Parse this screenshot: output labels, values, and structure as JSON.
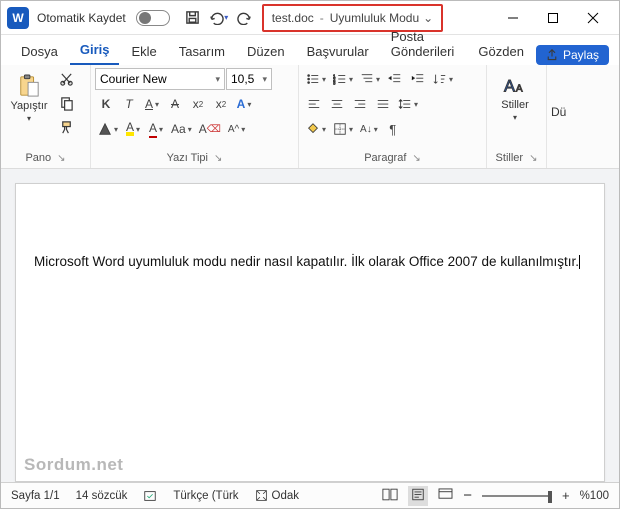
{
  "titlebar": {
    "autosave_label": "Otomatik Kaydet",
    "filename": "test.doc",
    "mode": "Uyumluluk Modu"
  },
  "tabs": {
    "dosya": "Dosya",
    "giris": "Giriş",
    "ekle": "Ekle",
    "tasarim": "Tasarım",
    "duzen": "Düzen",
    "basvurular": "Başvurular",
    "posta": "Posta Gönderileri",
    "gozden": "Gözden",
    "paylas": "Paylaş",
    "du": "Dü"
  },
  "ribbon": {
    "pano": {
      "label": "Pano",
      "paste": "Yapıştır"
    },
    "yazi": {
      "label": "Yazı Tipi",
      "font": "Courier New",
      "size": "10,5",
      "bold": "K",
      "italic": "T",
      "sub": "x",
      "sup": "x",
      "caseAa": "Aa",
      "clearA": "A",
      "fontA": "A",
      "colorA": "A",
      "highlightA": "A",
      "charA": "A",
      "underlineA": "A"
    },
    "para": {
      "label": "Paragraf"
    },
    "stil": {
      "label": "Stiller",
      "btn": "Stiller"
    }
  },
  "document": {
    "body": "Microsoft Word uyumluluk modu nedir nasıl kapatılır. İlk olarak Office 2007 de kullanılmıştır.",
    "watermark": "Sordum.net"
  },
  "status": {
    "page": "Sayfa 1/1",
    "words": "14 sözcük",
    "lang": "Türkçe (Türk",
    "focus": "Odak",
    "zoom_minus": "−",
    "zoom_plus": "+",
    "zoom": "%100"
  }
}
